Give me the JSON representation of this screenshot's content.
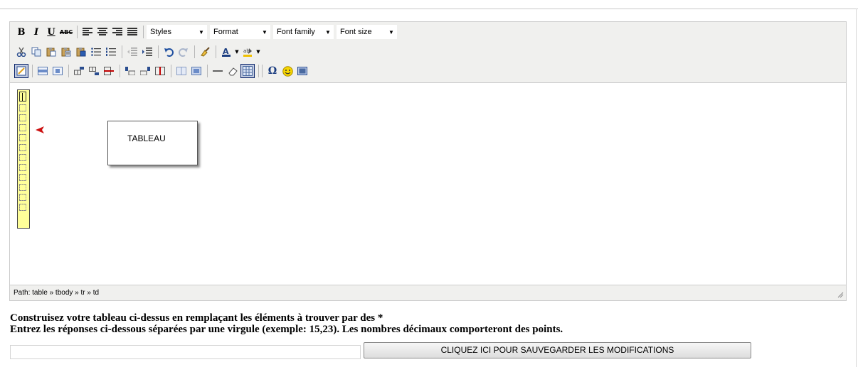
{
  "toolbar": {
    "row1": {
      "bold": "B",
      "italic": "I",
      "underline": "U",
      "strikethrough": "ABC",
      "styles": "Styles",
      "format": "Format",
      "font_family": "Font family",
      "font_size": "Font size"
    }
  },
  "content": {
    "callout_text": "TABLEAU"
  },
  "statusbar": {
    "path": "Path: table » tbody » tr » td"
  },
  "instructions": {
    "line1": "Construisez votre tableau ci-dessus en remplaçant les éléments à trouver par des *",
    "line2": "Entrez les réponses ci-dessous séparées par une virgule (exemple: 15,23). Les nombres décimaux comporteront des points."
  },
  "answer": {
    "value": "",
    "placeholder": ""
  },
  "save_button": {
    "label": "CLIQUEZ ICI POUR SAUVEGARDER LES MODIFICATIONS"
  },
  "colors": {
    "toolbar_bg": "#f0f0ee",
    "cell_highlight": "#ffff99",
    "arrow": "#cc0000",
    "active_button": "#c2cbe0"
  }
}
